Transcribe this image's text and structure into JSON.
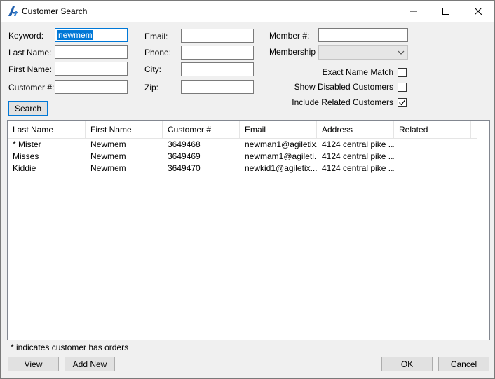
{
  "window": {
    "title": "Customer Search"
  },
  "form": {
    "keyword_label": "Keyword:",
    "keyword_value": "newmem",
    "last_name_label": "Last Name:",
    "first_name_label": "First Name:",
    "customer_no_label": "Customer #:",
    "email_label": "Email:",
    "phone_label": "Phone:",
    "city_label": "City:",
    "zip_label": "Zip:",
    "member_no_label": "Member #:",
    "membership_label": "Membership",
    "exact_name_match_label": "Exact Name Match",
    "exact_name_match_checked": false,
    "show_disabled_label": "Show Disabled Customers",
    "show_disabled_checked": false,
    "include_related_label": "Include Related Customers",
    "include_related_checked": true,
    "search_button": "Search"
  },
  "results": {
    "columns": [
      "Last Name",
      "First Name",
      "Customer #",
      "Email",
      "Address",
      "Related"
    ],
    "rows": [
      [
        "* Mister",
        "Newmem",
        "3649468",
        "newman1@agiletix....",
        "4124 central pike ...",
        ""
      ],
      [
        "Misses",
        "Newmem",
        "3649469",
        "newmam1@agileti...",
        "4124 central pike ...",
        ""
      ],
      [
        "Kiddie",
        "Newmem",
        "3649470",
        "newkid1@agiletix....",
        "4124 central pike ...",
        ""
      ]
    ]
  },
  "footer": {
    "note": "* indicates customer has orders",
    "view_button": "View",
    "add_new_button": "Add New",
    "ok_button": "OK",
    "cancel_button": "Cancel"
  },
  "colors": {
    "accent": "#0078d7",
    "brand_icon": "#1f5fae"
  }
}
